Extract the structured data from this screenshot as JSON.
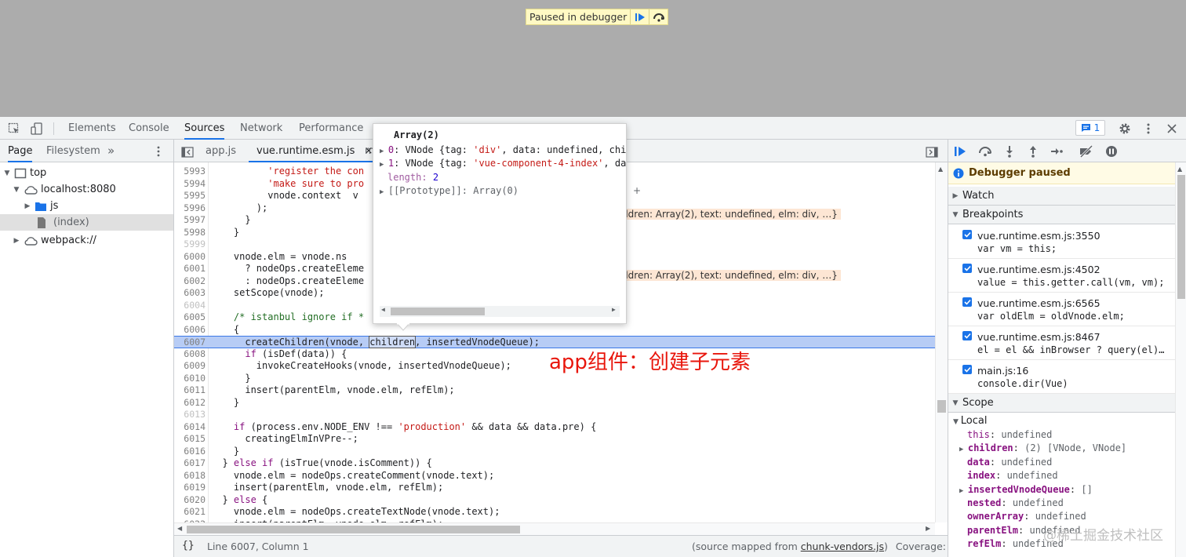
{
  "viewport": {
    "paused_label": "Paused in debugger"
  },
  "devtools_tabs": [
    "Elements",
    "Console",
    "Sources",
    "Network",
    "Performance"
  ],
  "message_count": "1",
  "navigator": {
    "tabs": [
      "Page",
      "Filesystem",
      "»"
    ],
    "tree": [
      {
        "label": "top",
        "icon": "frame-icon"
      },
      {
        "label": "localhost:8080",
        "icon": "cloud-icon"
      },
      {
        "label": "js",
        "icon": "folder-icon"
      },
      {
        "label": "(index)",
        "icon": "file-icon"
      },
      {
        "label": "webpack://",
        "icon": "cloud-icon"
      }
    ]
  },
  "editor": {
    "file_tabs": [
      "app.js",
      "vue.runtime.esm.js",
      "m"
    ],
    "lines": [
      {
        "n": "5993",
        "code": "          'register the con"
      },
      {
        "n": "5994",
        "code": "          'make sure to pro"
      },
      {
        "n": "5995",
        "code": "          vnode.context  v"
      },
      {
        "n": "5996",
        "code": "        );"
      },
      {
        "n": "5997",
        "code": "      }"
      },
      {
        "n": "5998",
        "code": "    }"
      },
      {
        "n": "5999",
        "code": ""
      },
      {
        "n": "6000",
        "code": "    vnode.elm = vnode.ns"
      },
      {
        "n": "6001",
        "code": "      ? nodeOps.createEleme"
      },
      {
        "n": "6002",
        "code": "      : nodeOps.createEleme"
      },
      {
        "n": "6003",
        "code": "    setScope(vnode);"
      },
      {
        "n": "6004",
        "code": ""
      },
      {
        "n": "6005",
        "code": "    /* istanbul ignore if *"
      },
      {
        "n": "6006",
        "code": "    {"
      },
      {
        "n": "6007",
        "code": "      createChildren(vnode, children, insertedVnodeQueue);"
      },
      {
        "n": "6008",
        "code": "      if (isDef(data)) {"
      },
      {
        "n": "6009",
        "code": "        invokeCreateHooks(vnode, insertedVnodeQueue);"
      },
      {
        "n": "6010",
        "code": "      }"
      },
      {
        "n": "6011",
        "code": "      insert(parentElm, vnode.elm, refElm);"
      },
      {
        "n": "6012",
        "code": "    }"
      },
      {
        "n": "6013",
        "code": ""
      },
      {
        "n": "6014",
        "code": "    if (process.env.NODE_ENV !== 'production' && data && data.pre) {"
      },
      {
        "n": "6015",
        "code": "      creatingElmInVPre--;"
      },
      {
        "n": "6016",
        "code": "    }"
      },
      {
        "n": "6017",
        "code": "  } else if (isTrue(vnode.isComment)) {"
      },
      {
        "n": "6018",
        "code": "    vnode.elm = nodeOps.createComment(vnode.text);"
      },
      {
        "n": "6019",
        "code": "    insert(parentElm, vnode.elm, refElm);"
      },
      {
        "n": "6020",
        "code": "  } else {"
      },
      {
        "n": "6021",
        "code": "    vnode.elm = nodeOps.createTextNode(vnode.text);"
      },
      {
        "n": "6022",
        "code": "    insert(parentElm, vnode.elm, refElm);"
      }
    ],
    "inline_value_1": "ildren: Array(2), text: undefined, elm: div, …}",
    "inline_value_2": "ildren: Array(2), text: undefined, elm: div, …}",
    "trailing_plus": "+",
    "annotation": "app组件：创建子元素",
    "status_position": "Line 6007, Column 1",
    "status_source_prefix": "(source mapped from ",
    "status_source_link": "chunk-vendors.js",
    "status_source_suffix": ")",
    "status_coverage": "Coverage: n/a"
  },
  "popover": {
    "title": "Array(2)",
    "rows": [
      {
        "key": "0",
        "text": ": VNode {tag: ",
        "str": "'div'",
        "rest": ", data: undefined, chi"
      },
      {
        "key": "1",
        "text": ": VNode {tag: ",
        "str": "'vue-component-4-index'",
        "rest": ", da"
      }
    ],
    "length_key": "length",
    "length_val": "2",
    "proto": "[[Prototype]]: Array(0)"
  },
  "debugger": {
    "paused_banner": "Debugger paused",
    "watch": "Watch",
    "breakpoints_label": "Breakpoints",
    "breakpoints": [
      {
        "file": "vue.runtime.esm.js:3550",
        "code": "var vm = this;"
      },
      {
        "file": "vue.runtime.esm.js:4502",
        "code": "value = this.getter.call(vm, vm);"
      },
      {
        "file": "vue.runtime.esm.js:6565",
        "code": "var oldElm = oldVnode.elm;"
      },
      {
        "file": "vue.runtime.esm.js:8467",
        "code": "el = el && inBrowser ? query(el)…"
      },
      {
        "file": "main.js:16",
        "code": "console.dir(Vue)"
      }
    ],
    "scope_label": "Scope",
    "local_label": "Local",
    "scope_vars": [
      {
        "name": "this",
        "value": "undefined",
        "bold": false,
        "expandable": false
      },
      {
        "name": "children",
        "value": "(2) [VNode, VNode]",
        "bold": true,
        "expandable": true
      },
      {
        "name": "data",
        "value": "undefined",
        "bold": true,
        "expandable": false
      },
      {
        "name": "index",
        "value": "undefined",
        "bold": true,
        "expandable": false
      },
      {
        "name": "insertedVnodeQueue",
        "value": "[]",
        "bold": true,
        "expandable": true
      },
      {
        "name": "nested",
        "value": "undefined",
        "bold": true,
        "expandable": false
      },
      {
        "name": "ownerArray",
        "value": "undefined",
        "bold": true,
        "expandable": false
      },
      {
        "name": "parentElm",
        "value": "undefined",
        "bold": true,
        "expandable": false
      },
      {
        "name": "refElm",
        "value": "undefined",
        "bold": true,
        "expandable": false
      }
    ]
  },
  "watermark": "@稀土掘金技术社区",
  "colors": {
    "accent": "#1a73e8",
    "paused_bg": "#fff9c4",
    "highlight": "#b7ccf5"
  }
}
